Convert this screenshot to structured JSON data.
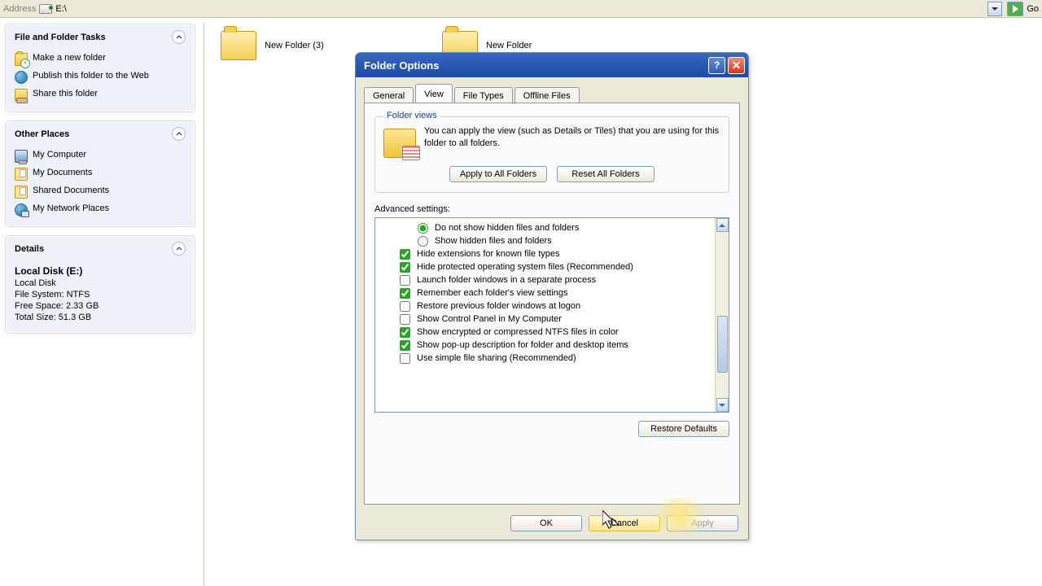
{
  "addressbar": {
    "label": "Address",
    "path": "E:\\",
    "go_label": "Go"
  },
  "tasks": {
    "file_folder": {
      "header": "File and Folder Tasks",
      "items": [
        "Make a new folder",
        "Publish this folder to the Web",
        "Share this folder"
      ]
    },
    "other_places": {
      "header": "Other Places",
      "items": [
        "My Computer",
        "My Documents",
        "Shared Documents",
        "My Network Places"
      ]
    },
    "details": {
      "header": "Details",
      "title": "Local Disk (E:)",
      "type": "Local Disk",
      "fs": "File System: NTFS",
      "free": "Free Space: 2.33 GB",
      "total": "Total Size: 51.3 GB"
    }
  },
  "folders": {
    "f1": "New Folder (3)",
    "f2": "New Folder"
  },
  "dialog": {
    "title": "Folder Options",
    "tabs": {
      "general": "General",
      "view": "View",
      "filetypes": "File Types",
      "offline": "Offline Files"
    },
    "folderviews": {
      "legend": "Folder views",
      "text": "You can apply the view (such as Details or Tiles) that you are using for this folder to all folders.",
      "apply_all": "Apply to All Folders",
      "reset_all": "Reset All Folders"
    },
    "advanced_label": "Advanced settings:",
    "advanced": [
      {
        "type": "radio",
        "checked": true,
        "indent": true,
        "label": "Do not show hidden files and folders"
      },
      {
        "type": "radio",
        "checked": false,
        "indent": true,
        "label": "Show hidden files and folders"
      },
      {
        "type": "check",
        "checked": true,
        "label": "Hide extensions for known file types"
      },
      {
        "type": "check",
        "checked": true,
        "label": "Hide protected operating system files (Recommended)"
      },
      {
        "type": "check",
        "checked": false,
        "label": "Launch folder windows in a separate process"
      },
      {
        "type": "check",
        "checked": true,
        "label": "Remember each folder's view settings"
      },
      {
        "type": "check",
        "checked": false,
        "label": "Restore previous folder windows at logon"
      },
      {
        "type": "check",
        "checked": false,
        "label": "Show Control Panel in My Computer"
      },
      {
        "type": "check",
        "checked": true,
        "label": "Show encrypted or compressed NTFS files in color"
      },
      {
        "type": "check",
        "checked": true,
        "label": "Show pop-up description for folder and desktop items"
      },
      {
        "type": "check",
        "checked": false,
        "label": "Use simple file sharing (Recommended)"
      }
    ],
    "restore_defaults": "Restore Defaults",
    "ok": "OK",
    "cancel": "Cancel",
    "apply": "Apply"
  }
}
